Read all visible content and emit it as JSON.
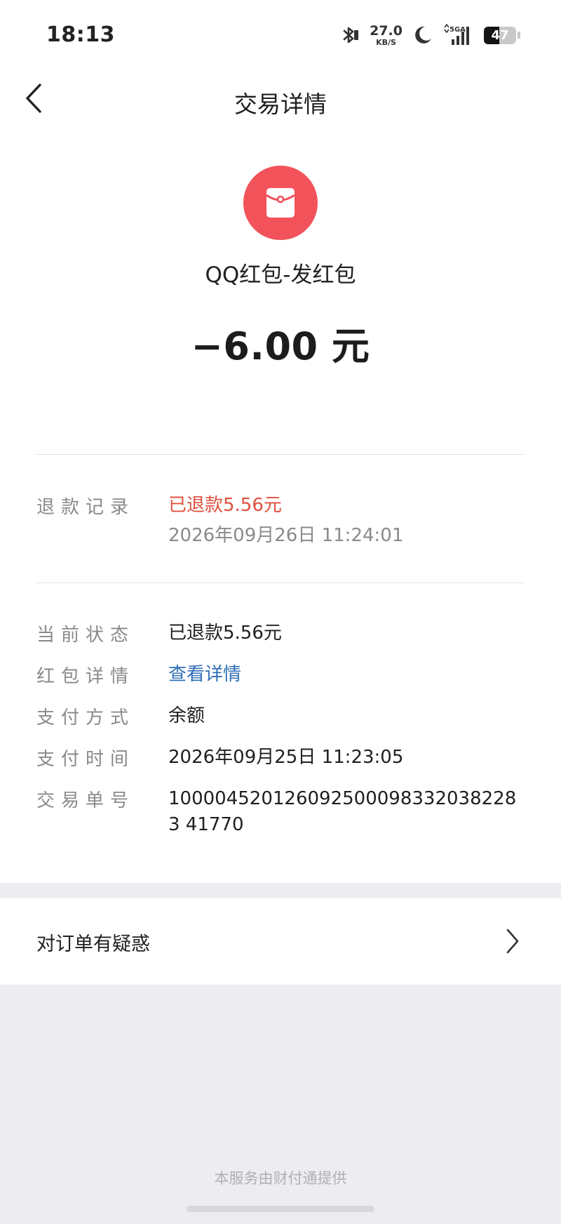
{
  "status_bar": {
    "time": "18:13",
    "net_speed_value": "27.0",
    "net_speed_unit": "KB/S",
    "network_type": "5GA",
    "battery_level": "47",
    "battery_fraction": 0.47
  },
  "header": {
    "title": "交易详情"
  },
  "summary": {
    "merchant": "QQ红包-发红包",
    "amount": "−6.00 元",
    "badge_color": "#f2525a"
  },
  "refund": {
    "label": "退款记录",
    "amount_text": "已退款5.56元",
    "time": "2026年09月26日 11:24:01"
  },
  "details": [
    {
      "label": "当前状态",
      "value": "已退款5.56元"
    },
    {
      "label": "红包详情",
      "value": "查看详情"
    },
    {
      "label": "支付方式",
      "value": "余额"
    },
    {
      "label": "支付时间",
      "value": "2026年09月25日 11:23:05"
    },
    {
      "label": "交易单号",
      "value": "1000045201260925000983320382283 41770"
    }
  ],
  "dispute": {
    "label": "对订单有疑惑"
  },
  "footer": {
    "note": "本服务由财付通提供"
  },
  "colors": {
    "refund_red": "#e0503f",
    "link_blue": "#2f6fb8",
    "page_bg": "#ededf1"
  }
}
